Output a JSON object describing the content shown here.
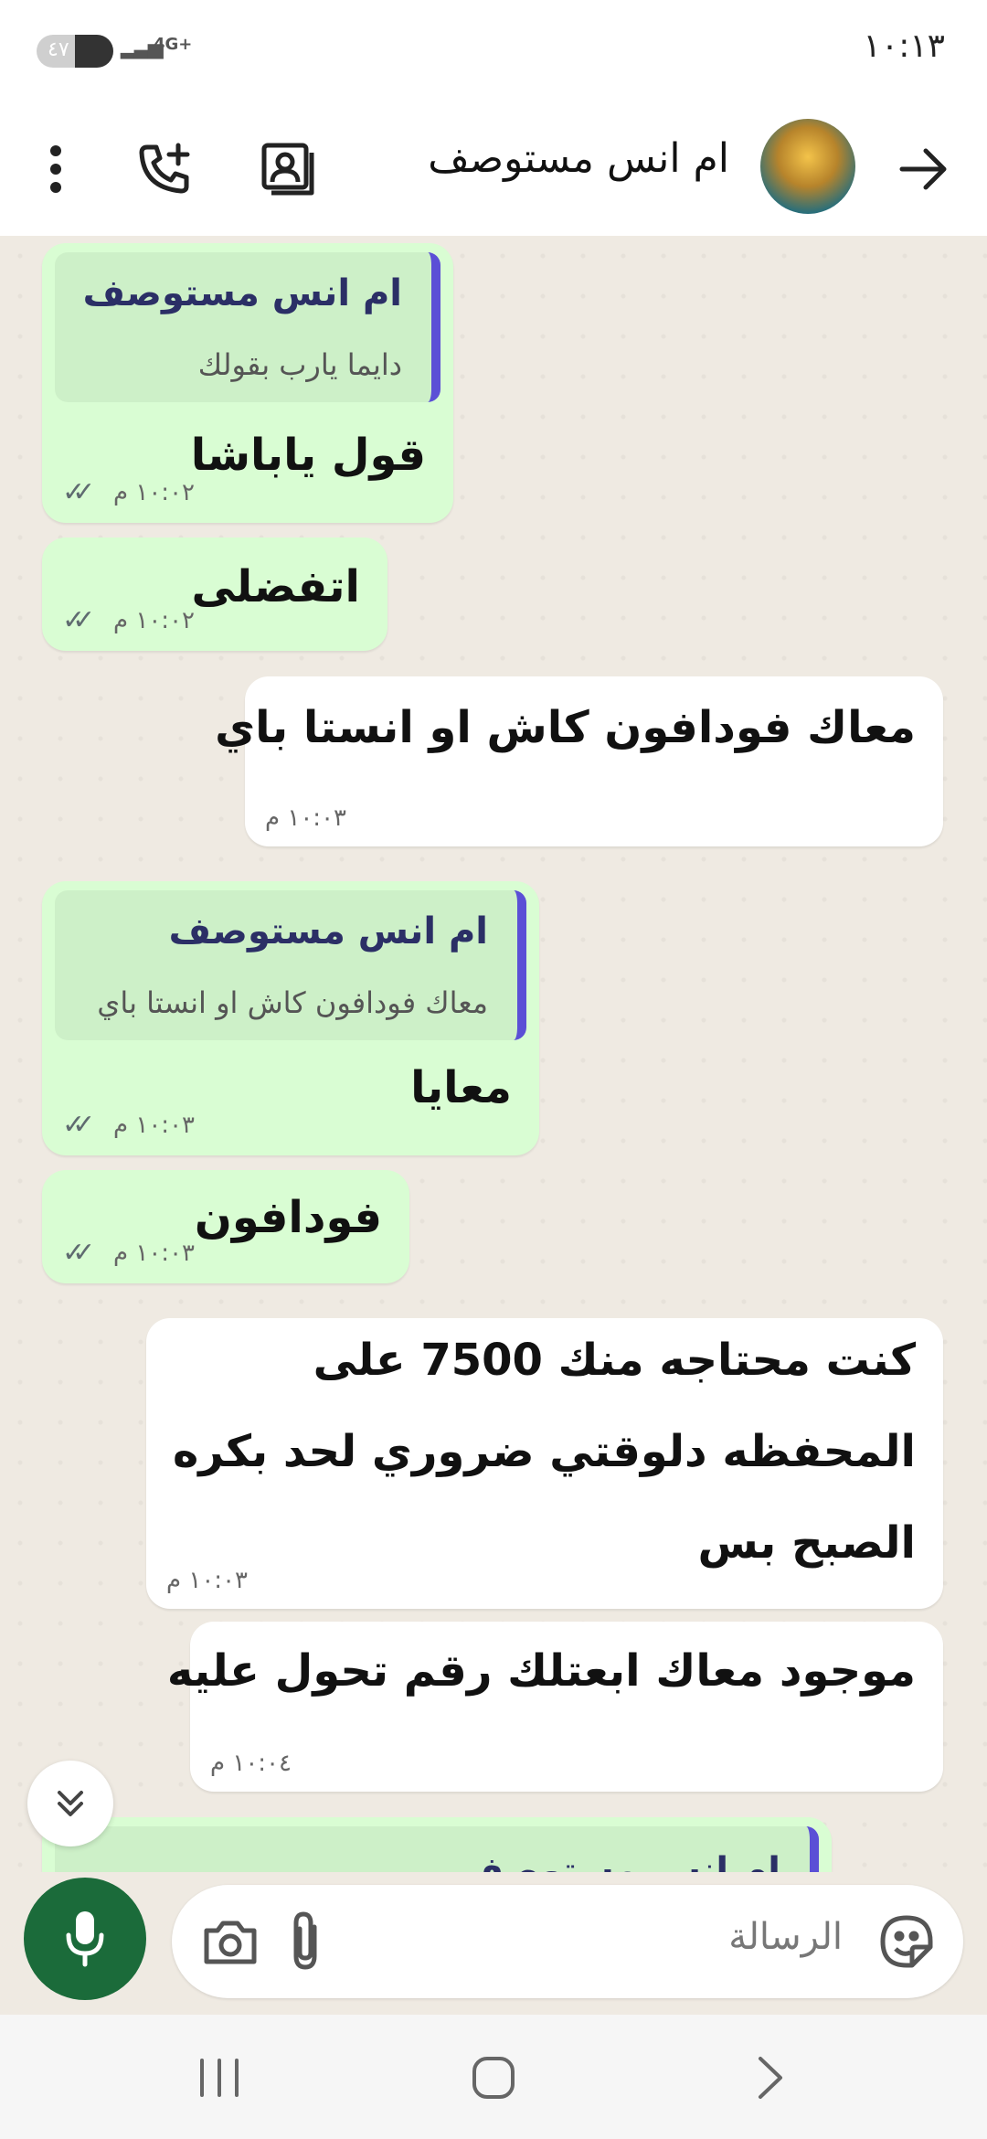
{
  "status_bar": {
    "time": "١٠:١٣",
    "battery": "٤٧",
    "network": "4G+"
  },
  "header": {
    "contact_name": "ام انس مستوصف",
    "icons": [
      "back-arrow-icon",
      "add-call-icon",
      "contact-card-icon",
      "more-options-icon"
    ]
  },
  "messages": [
    {
      "direction": "out",
      "quote": {
        "name": "ام انس مستوصف",
        "text": "دايما يارب بقولك"
      },
      "text": "قول ياباشا",
      "time": "١٠:٠٢ م",
      "status": "read"
    },
    {
      "direction": "out",
      "text": "اتفضلى",
      "time": "١٠:٠٢ م",
      "status": "read"
    },
    {
      "direction": "in",
      "text": "معاك فودافون كاش او انستا باي",
      "time": "١٠:٠٣ م"
    },
    {
      "direction": "out",
      "quote": {
        "name": "ام انس مستوصف",
        "text": "معاك فودافون كاش او انستا باي"
      },
      "text": "معايا",
      "time": "١٠:٠٣ م",
      "status": "read"
    },
    {
      "direction": "out",
      "text": "فودافون",
      "time": "١٠:٠٣ م",
      "status": "read"
    },
    {
      "direction": "in",
      "lines": [
        "كنت محتاجه منك 7500 على",
        "المحفظه دلوقتي ضروري لحد بكره",
        "الصبح بس"
      ],
      "time": "١٠:٠٣ م"
    },
    {
      "direction": "in",
      "text": "موجود معاك ابعتلك رقم تحول عليه",
      "time": "١٠:٠٤ م"
    },
    {
      "direction": "out",
      "quote": {
        "name": "ام انس مستوصف",
        "text": ""
      },
      "partial": true
    }
  ],
  "composer": {
    "placeholder": "الرسالة",
    "icons": [
      "sticker-icon",
      "attach-icon",
      "camera-icon",
      "mic-icon"
    ]
  },
  "nav": {
    "icons": [
      "recents-icon",
      "home-icon",
      "back-icon"
    ]
  },
  "colors": {
    "outgoing": "#d9fdd3",
    "incoming": "#ffffff",
    "quote_bar": "#5b4fd6",
    "mic": "#1b6b3a"
  }
}
